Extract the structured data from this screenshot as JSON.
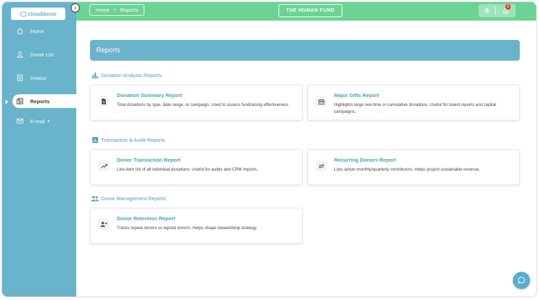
{
  "app": {
    "logo_text": "clouddonor",
    "org_name": "THE HUMAN FUND",
    "notification_count": "1"
  },
  "colors": {
    "sidebar": "#69b3cb",
    "header": "#6bd494",
    "accent": "#4a9cbf",
    "banner": "#6ab3cb"
  },
  "sidebar": {
    "items": [
      {
        "label": "Home",
        "icon": "home-icon"
      },
      {
        "label": "Donor List",
        "icon": "user-icon"
      },
      {
        "label": "Invoice",
        "icon": "invoice-icon"
      },
      {
        "label": "Reports",
        "icon": "reports-icon",
        "active": true
      },
      {
        "label": "E-mail",
        "icon": "mail-icon"
      }
    ]
  },
  "breadcrumb": {
    "home": "Home",
    "separator": "»",
    "current": "Reports"
  },
  "page": {
    "title": "Reports"
  },
  "sections": [
    {
      "title": "Donation Analysis Reports",
      "icon": "bar-chart-icon",
      "cards": [
        {
          "title": "Donation Summary Report",
          "description": "Total donations by type, date range, or campaign. Used to assess fundraising effectiveness.",
          "icon": "document-icon"
        },
        {
          "title": "Major Gifts Report",
          "description": "Highlights large one-time or cumulative donations. Useful for board reports and capital campaigns.",
          "icon": "gift-icon"
        }
      ]
    },
    {
      "title": "Transaction & Audit Reports",
      "icon": "audit-chart-icon",
      "cards": [
        {
          "title": "Donor Transaction Report",
          "description": "Line-item list of all individual donations. Useful for audits and CRM imports.",
          "icon": "trend-icon"
        },
        {
          "title": "Recurring Donors Report",
          "description": "Lists active monthly/quarterly contributors. Helps project sustainable revenue.",
          "icon": "repeat-icon"
        }
      ]
    },
    {
      "title": "Donor Management Reports",
      "icon": "group-icon",
      "cards": [
        {
          "title": "Donor Retention Report",
          "description": "Tracks repeat donors vs lapsed donors. Helps shape stewardship strategy.",
          "icon": "person-add-icon"
        }
      ]
    }
  ]
}
